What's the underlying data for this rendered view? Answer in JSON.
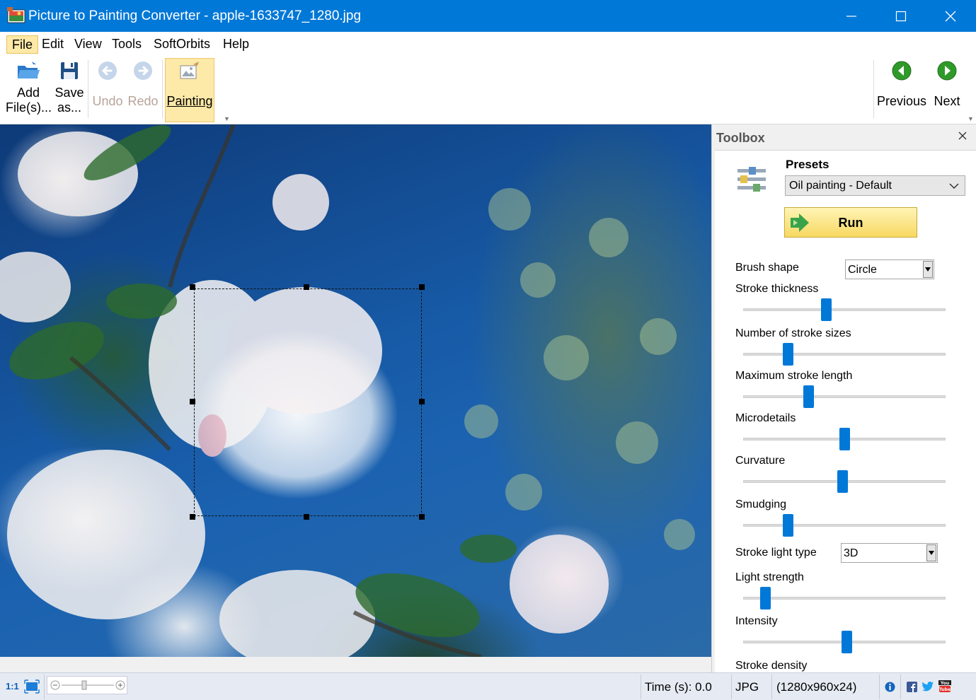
{
  "window": {
    "title": "Picture to Painting Converter - apple-1633747_1280.jpg"
  },
  "menu": {
    "items": [
      {
        "label": "File"
      },
      {
        "label": "Edit"
      },
      {
        "label": "View"
      },
      {
        "label": "Tools"
      },
      {
        "label": "SoftOrbits"
      },
      {
        "label": "Help"
      }
    ]
  },
  "ribbon": {
    "add_files": {
      "line1": "Add",
      "line2": "File(s)..."
    },
    "save_as": {
      "line1": "Save",
      "line2": "as..."
    },
    "undo": "Undo",
    "redo": "Redo",
    "painting": "Painting",
    "previous": "Previous",
    "next": "Next"
  },
  "toolbox": {
    "title": "Toolbox",
    "presets_label": "Presets",
    "preset_value": "Oil painting - Default",
    "run_label": "Run",
    "brush_shape_label": "Brush shape",
    "brush_shape_value": "Circle",
    "stroke_light_type_label": "Stroke light type",
    "stroke_light_type_value": "3D",
    "sliders": [
      {
        "label": "Stroke thickness",
        "value": 0.41
      },
      {
        "label": "Number of stroke sizes",
        "value": 0.22
      },
      {
        "label": "Maximum stroke length",
        "value": 0.32
      },
      {
        "label": "Microdetails",
        "value": 0.5
      },
      {
        "label": "Curvature",
        "value": 0.49
      },
      {
        "label": "Smudging",
        "value": 0.22
      },
      {
        "label": "Light strength",
        "value": 0.11
      },
      {
        "label": "Intensity",
        "value": 0.51
      }
    ],
    "stroke_density_label": "Stroke density"
  },
  "statusbar": {
    "zoom_actual": "1:1",
    "time": "Time (s): 0.0",
    "format": "JPG",
    "dimensions": "(1280x960x24)"
  },
  "colors": {
    "titlebar": "#0078d7",
    "slider_thumb": "#0078d7",
    "accent_highlight": "#fde9a8"
  }
}
